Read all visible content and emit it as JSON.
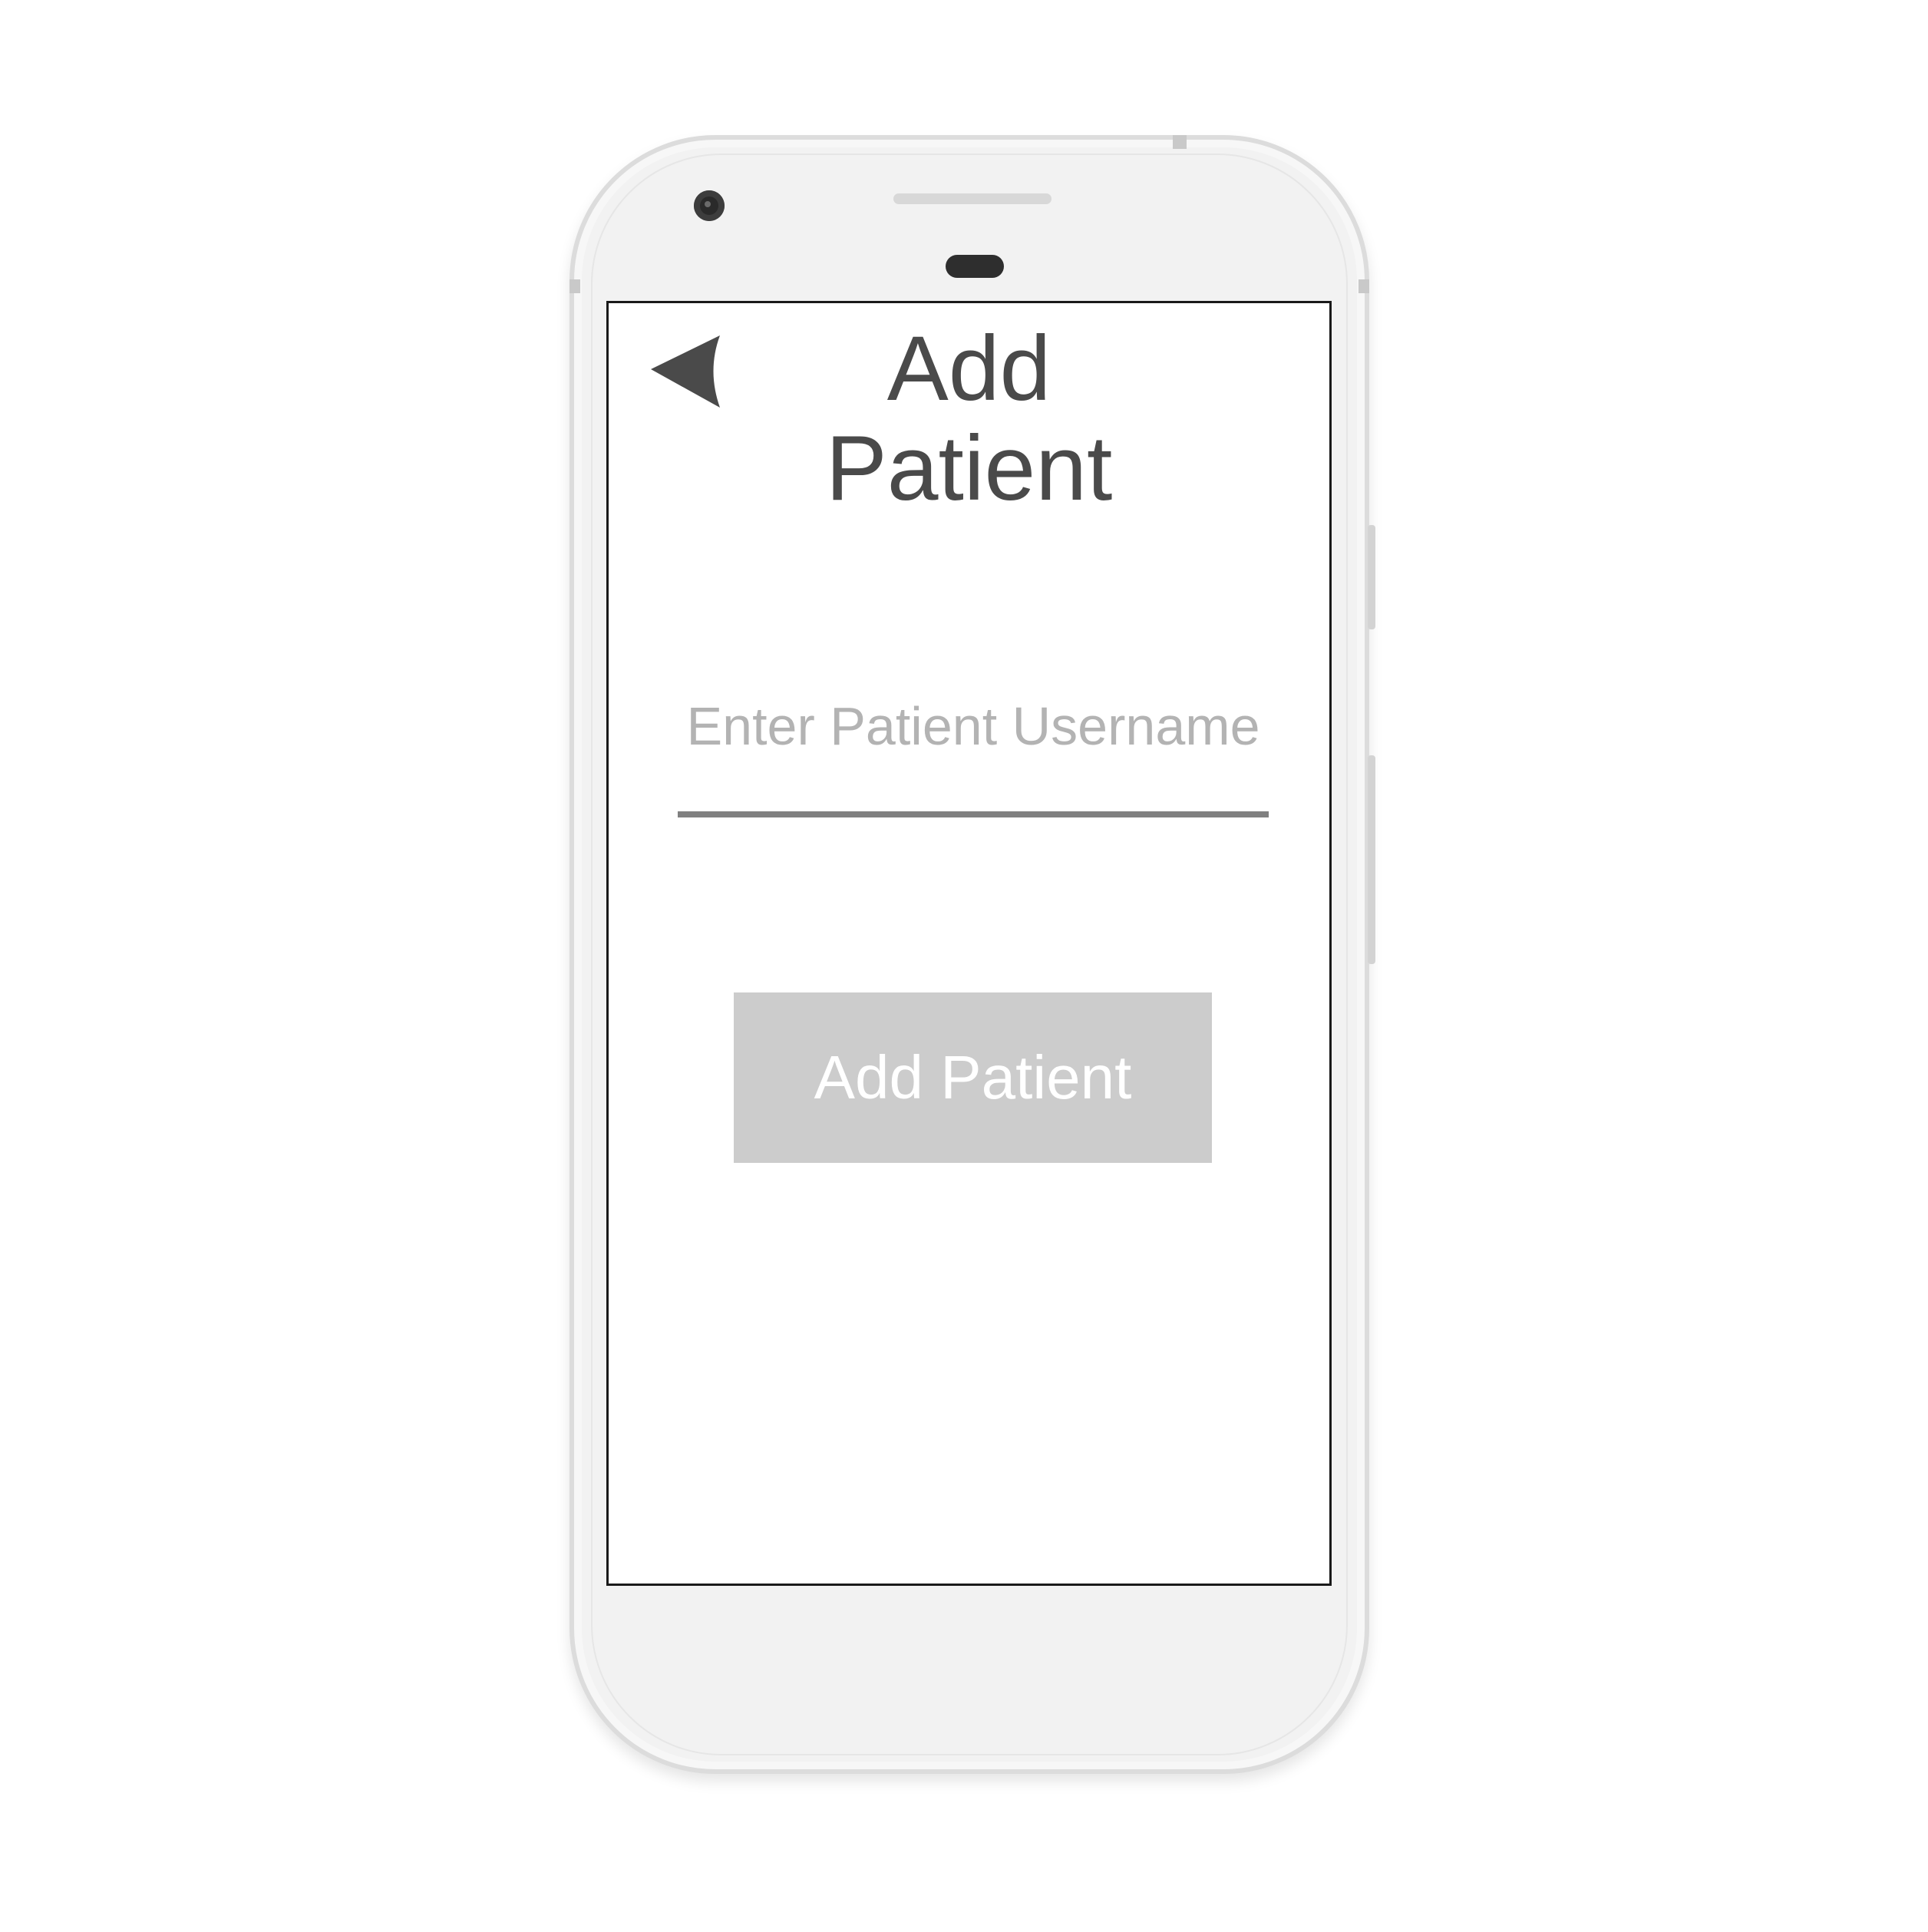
{
  "header": {
    "title_line1": "Add",
    "title_line2": "Patient",
    "back_icon": "back-arrow-icon"
  },
  "form": {
    "username_placeholder": "Enter Patient Username",
    "username_value": ""
  },
  "actions": {
    "add_patient_label": "Add Patient"
  },
  "colors": {
    "title_text": "#4a4a4a",
    "placeholder_text": "#b3b3b3",
    "underline": "#808080",
    "button_background": "#cccccc",
    "button_text": "#ffffff",
    "phone_body": "#f2f2f2"
  }
}
